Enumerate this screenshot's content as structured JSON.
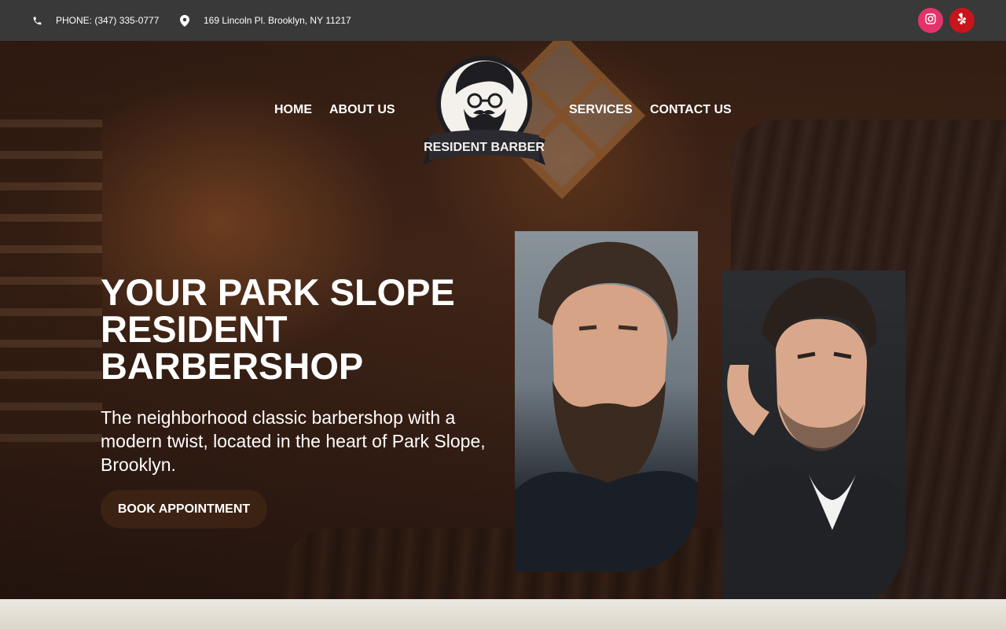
{
  "topbar": {
    "phone": "PHONE: (347) 335-0777",
    "phone_icon": "phone-icon",
    "address": "169 Lincoln Pl. Brooklyn, NY 11217",
    "address_icon": "map-pin-icon",
    "social": [
      {
        "name": "instagram",
        "icon": "instagram-icon",
        "color": "#e4336a"
      },
      {
        "name": "yelp",
        "icon": "yelp-icon",
        "color": "#c8141b"
      }
    ],
    "background": "#393939"
  },
  "nav": {
    "home": "HOME",
    "about": "ABOUT US",
    "services": "SERVICES",
    "contact": "CONTACT US"
  },
  "logo": {
    "text": "RESIDENT BARBER"
  },
  "hero": {
    "headline_lines": [
      "YOUR PARK SLOPE",
      "RESIDENT",
      "BARBERSHOP"
    ],
    "subtext": "The neighborhood classic barbershop with a modern twist, located in the heart of Park Slope, Brooklyn.",
    "cta": "BOOK APPOINTMENT",
    "cta_color": "#3b2213"
  }
}
